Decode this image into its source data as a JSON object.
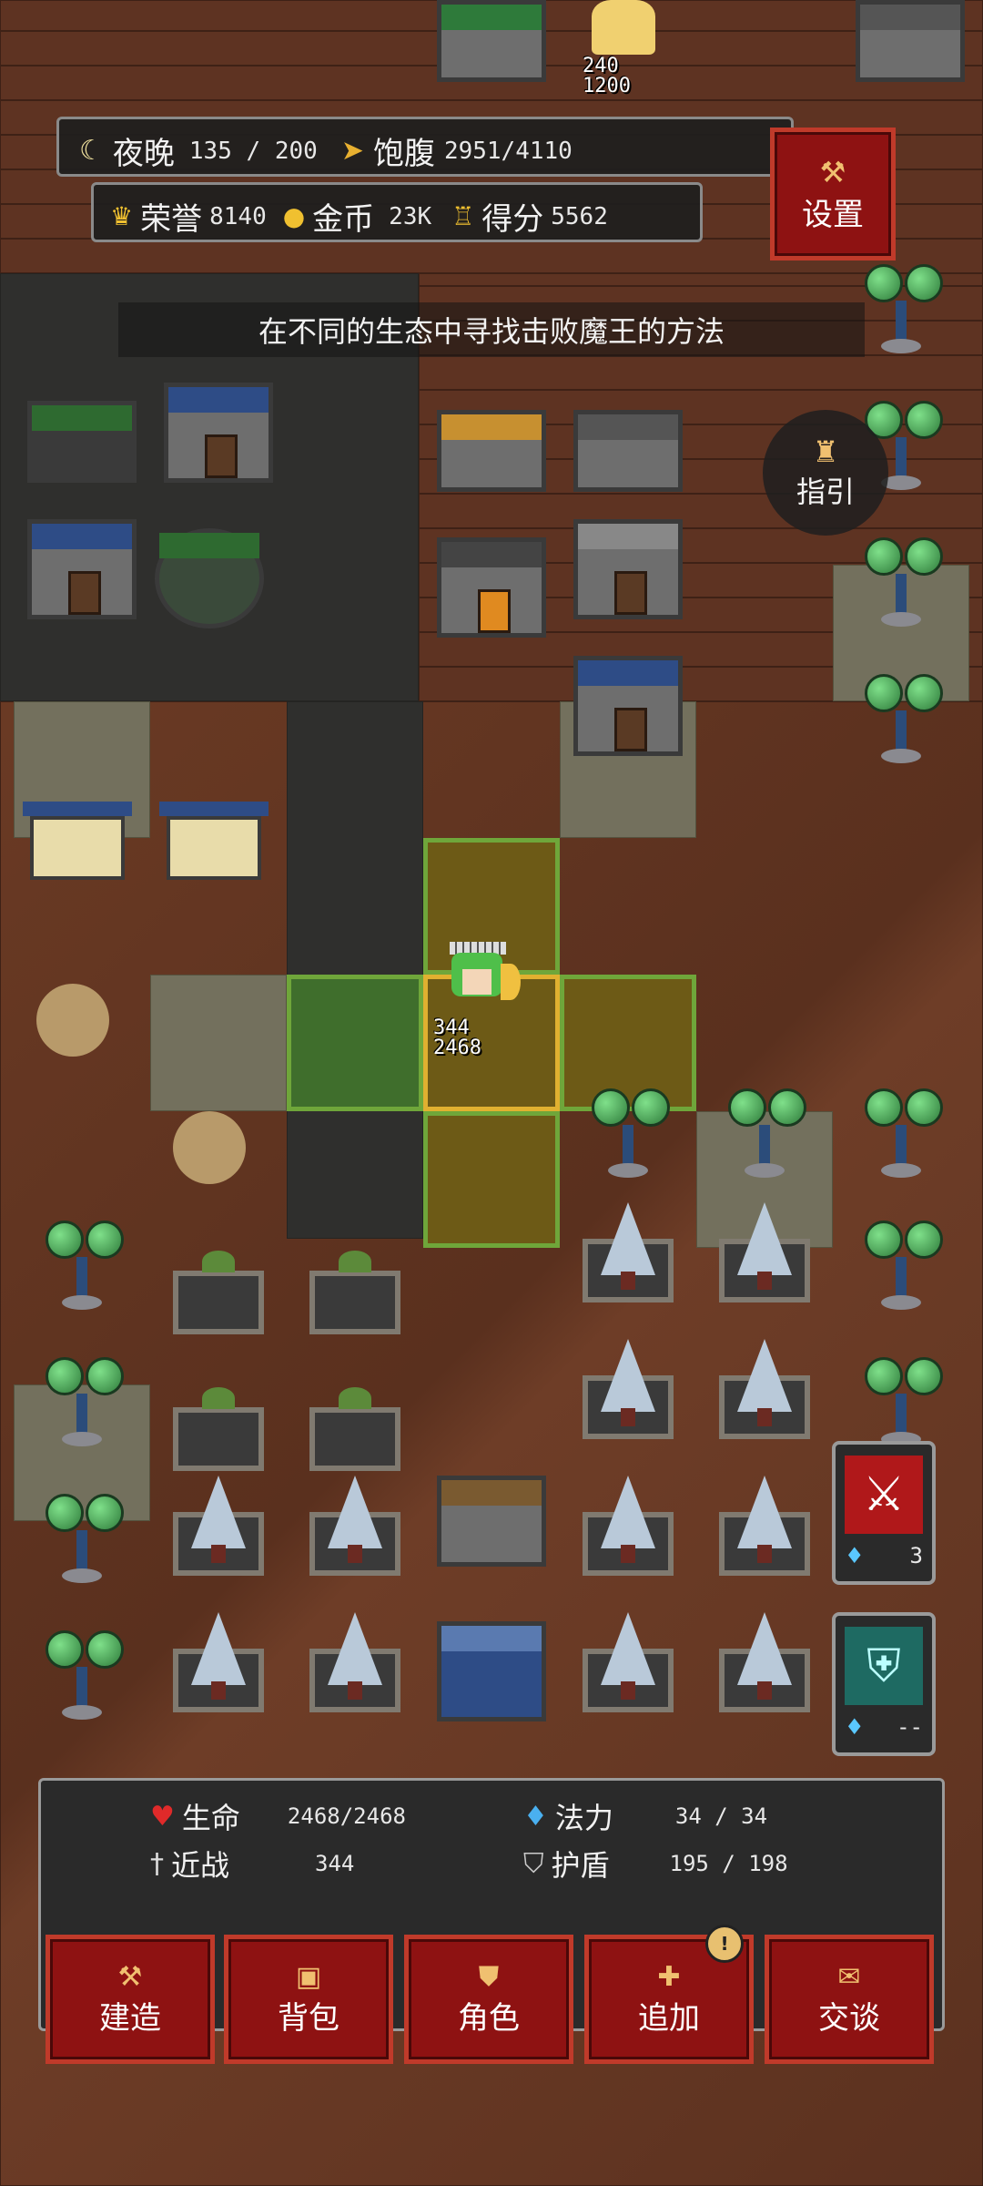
{
  "top_bar": {
    "night_label": "夜晚",
    "night_value": "135 / 200",
    "satiety_label": "饱腹",
    "satiety_value": "2951/4110",
    "honor_label": "荣誉",
    "honor_value": "8140",
    "gold_label": "金币",
    "gold_value": "23K",
    "score_label": "得分",
    "score_value": "5562",
    "settings_label": "设置"
  },
  "hint_text": "在不同的生态中寻找击败魔王的方法",
  "guide_label": "指引",
  "npc_angel": {
    "attack": "240",
    "health": "1200"
  },
  "player": {
    "attack": "344",
    "health": "2468"
  },
  "skills": [
    {
      "name": "sword-skill",
      "cost": "3"
    },
    {
      "name": "shield-skill",
      "cost": "--"
    }
  ],
  "stats_panel": {
    "hp_label": "生命",
    "hp_value": "2468/2468",
    "mp_label": "法力",
    "mp_value": "34 / 34",
    "melee_label": "近战",
    "melee_value": "344",
    "shield_label": "护盾",
    "shield_value": "195 / 198"
  },
  "bottom_buttons": [
    {
      "label": "建造",
      "icon": "hammer-icon"
    },
    {
      "label": "背包",
      "icon": "bag-icon"
    },
    {
      "label": "角色",
      "icon": "character-icon"
    },
    {
      "label": "追加",
      "icon": "plus-icon"
    },
    {
      "label": "交谈",
      "icon": "speech-icon"
    }
  ],
  "colors": {
    "button_red": "#8e1212",
    "highlight_green": "#6fa63a",
    "selected_gold": "#e0b030"
  }
}
